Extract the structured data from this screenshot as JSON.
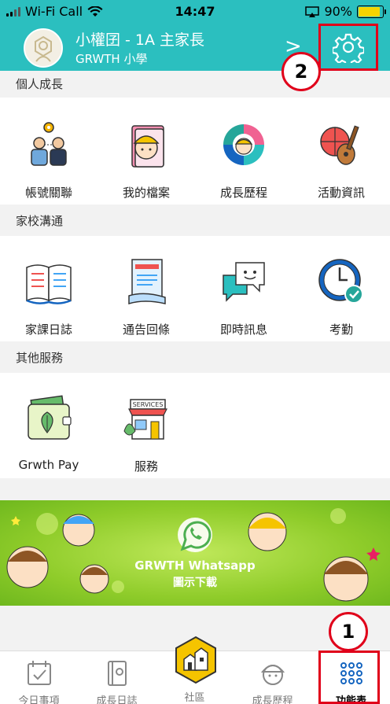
{
  "status_bar": {
    "carrier": "Wi-Fi Call",
    "time": "14:47",
    "battery_pct": "90%",
    "battery_level": 0.9
  },
  "header": {
    "name": "小權囝 - 1A 主家長",
    "school": "GRWTH 小學",
    "chevron": ">",
    "bg_color": "#2bbfbf"
  },
  "sections": [
    {
      "title": "個人成長",
      "items": [
        {
          "label": "帳號關聯",
          "icon": "account-link-icon"
        },
        {
          "label": "我的檔案",
          "icon": "my-file-icon"
        },
        {
          "label": "成長歷程",
          "icon": "growth-journey-icon"
        },
        {
          "label": "活動資訊",
          "icon": "activity-info-icon"
        }
      ]
    },
    {
      "title": "家校溝通",
      "items": [
        {
          "label": "家課日誌",
          "icon": "homework-diary-icon"
        },
        {
          "label": "通告回條",
          "icon": "notice-reply-icon"
        },
        {
          "label": "即時訊息",
          "icon": "instant-message-icon"
        },
        {
          "label": "考勤",
          "icon": "attendance-icon"
        }
      ]
    },
    {
      "title": "其他服務",
      "items": [
        {
          "label": "Grwth Pay",
          "icon": "wallet-icon"
        },
        {
          "label": "服務",
          "icon": "services-store-icon"
        }
      ]
    }
  ],
  "banner": {
    "title": "GRWTH Whatsapp",
    "subtitle": "圖示下載"
  },
  "services_sign": "SERVICES",
  "tabbar": [
    {
      "label": "今日事項",
      "icon": "calendar-check-icon"
    },
    {
      "label": "成長日誌",
      "icon": "journal-icon"
    },
    {
      "label": "社區",
      "icon": "community-icon"
    },
    {
      "label": "成長歷程",
      "icon": "helmet-icon"
    },
    {
      "label": "功能表",
      "icon": "grid-menu-icon",
      "active": true
    }
  ],
  "callouts": {
    "one": "1",
    "two": "2"
  },
  "annotation_color": "#e0001a"
}
